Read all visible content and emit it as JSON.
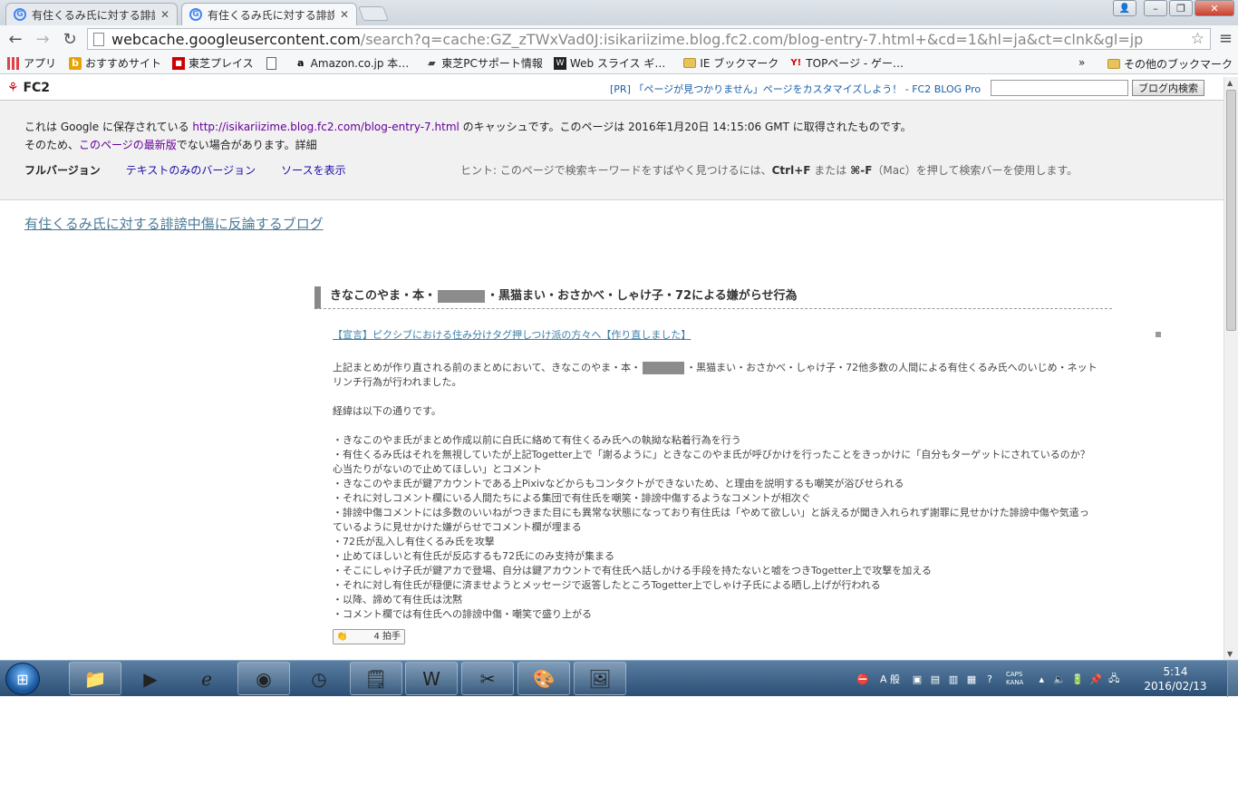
{
  "browser": {
    "tabs": [
      {
        "title": "有住くるみ氏に対する誹謗",
        "active": false
      },
      {
        "title": "有住くるみ氏に対する誹謗",
        "active": true
      }
    ],
    "url_host": "webcache.googleusercontent.com",
    "url_path": "/search?q=cache:GZ_zTWxVad0J:isikariizime.blog.fc2.com/blog-entry-7.html+&cd=1&hl=ja&ct=clnk&gl=jp",
    "bookmarks": [
      {
        "label": "アプリ",
        "icon": "apps-grid-icon"
      },
      {
        "label": "おすすめサイト",
        "icon": "bing-icon"
      },
      {
        "label": "東芝プレイス",
        "icon": "toshiba-place-icon"
      },
      {
        "label": "",
        "icon": "page-icon"
      },
      {
        "label": "Amazon.co.jp 本…",
        "icon": "amazon-icon"
      },
      {
        "label": "東芝PCサポート情報",
        "icon": "toshiba-icon"
      },
      {
        "label": "Web スライス ギ…",
        "icon": "web-slice-icon"
      },
      {
        "label": "IE ブックマーク",
        "icon": "folder-icon"
      },
      {
        "label": "TOPページ - ゲー…",
        "icon": "yahoo-icon"
      }
    ],
    "bookmarks_more": "»",
    "bookmarks_other": "その他のブックマーク"
  },
  "fc2": {
    "logo": "FC2",
    "ad_text": "[PR] 「ページが見つかりません」ページをカスタマイズしよう！ - FC2 BLOG Pro",
    "search_button": "ブログ内検索"
  },
  "cache": {
    "line1_pre": "これは Google に保存されている ",
    "line1_link": "http://isikariizime.blog.fc2.com/blog-entry-7.html",
    "line1_post": " のキャッシュです。このページは 2016年1月20日 14:15:06 GMT に取得されたものです。",
    "line2_pre": "そのため、",
    "line2_link": "このページの最新版",
    "line2_mid": "でない場合があります。",
    "line2_detail": "詳細",
    "opt_full": "フルバージョン",
    "opt_text": "テキストのみのバージョン",
    "opt_source": "ソースを表示",
    "hint_pre": "ヒント: このページで検索キーワードをすばやく見つけるには、",
    "hint_ctrlf": "Ctrl+F",
    "hint_mid": " または ",
    "hint_cmdf": "⌘-F",
    "hint_post": "（Mac）を押して検索バーを使用します。"
  },
  "blog": {
    "title": "有住くるみ氏に対する誹謗中傷に反論するブログ",
    "entry_title_pre": "きなこのやま・本・",
    "entry_title_post": "・黒猫まい・おさかべ・しゃけ子・72による嫌がらせ行為",
    "link": "【宣言】ピクシブにおける住み分けタグ押しつけ派の方々へ【作り直しました】",
    "para1_pre": "上記まとめが作り直される前のまとめにおいて、きなこのやま・本・",
    "para1_post": "・黒猫まい・おさかべ・しゃけ子・72他多数の人間による有住くるみ氏へのいじめ・ネットリンチ行為が行われました。",
    "para2": "経緯は以下の通りです。",
    "items": [
      "・きなこのやま氏がまとめ作成以前に白氏に絡めて有住くるみ氏への執拗な粘着行為を行う",
      "・有住くるみ氏はそれを無視していたが上記Togetter上で「謝るように」ときなこのやま氏が呼びかけを行ったことをきっかけに「自分もターゲットにされているのか？心当たりがないので止めてほしい」とコメント",
      "・きなこのやま氏が鍵アカウントである上Pixivなどからもコンタクトができないため、と理由を説明するも嘲笑が浴びせられる",
      "・それに対しコメント欄にいる人間たちによる集団で有住氏を嘲笑・誹謗中傷するようなコメントが相次ぐ",
      "・誹謗中傷コメントには多数のいいねがつきまた目にも異常な状態になっており有住氏は「やめて欲しい」と訴えるが聞き入れられず謝罪に見せかけた誹謗中傷や気遣っているように見せかけた嫌がらせでコメント欄が埋まる",
      "・72氏が乱入し有住くるみ氏を攻撃",
      "・止めてほしいと有住氏が反応するも72氏にのみ支持が集まる",
      "・そこにしゃけ子氏が鍵アカで登場、自分は鍵アカウントで有住氏へ話しかける手段を持たないと嘘をつきTogetter上で攻撃を加える",
      "・それに対し有住氏が穏便に済ませようとメッセージで返答したところTogetter上でしゃけ子氏による晒し上げが行われる",
      "・以降、諦めて有住氏は沈黙",
      "・コメント欄では有住氏への誹謗中傷・嘲笑で盛り上がる"
    ],
    "clap_count": "4 拍手"
  },
  "taskbar": {
    "ime_mode": "A 般",
    "caps": "CAPS",
    "kana": "KANA",
    "time": "5:14",
    "date": "2016/02/13"
  }
}
